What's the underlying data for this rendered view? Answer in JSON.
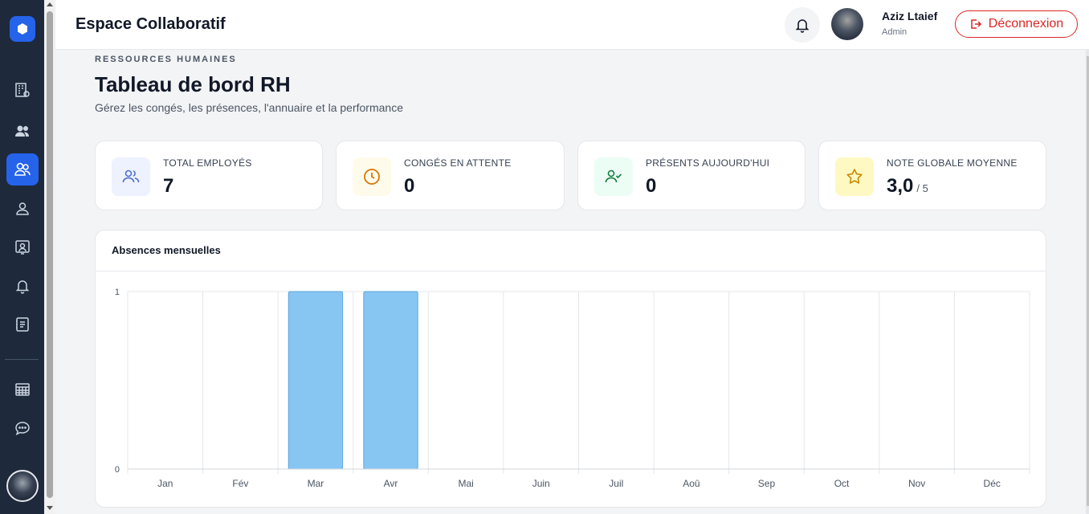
{
  "header": {
    "app_title": "Espace Collaboratif",
    "user_name": "Aziz Ltaief",
    "user_role": "Admin",
    "logout_label": "Déconnexion"
  },
  "page": {
    "kicker": "RESSOURCES HUMAINES",
    "title": "Tableau de bord RH",
    "subtitle": "Gérez les congés, les présences, l'annuaire et la performance"
  },
  "stats": [
    {
      "label": "TOTAL EMPLOYÉS",
      "value": "7",
      "icon": "users-icon",
      "color": "#4f6fd6",
      "bg": "#eef2ff"
    },
    {
      "label": "CONGÉS EN ATTENTE",
      "value": "0",
      "icon": "clock-icon",
      "color": "#d97706",
      "bg": "#fffbeb"
    },
    {
      "label": "PRÉSENTS AUJOURD'HUI",
      "value": "0",
      "icon": "user-check-icon",
      "color": "#15803d",
      "bg": "#ecfdf5"
    },
    {
      "label": "NOTE GLOBALE MOYENNE",
      "value": "3,0",
      "suffix": "/ 5",
      "icon": "star-icon",
      "color": "#ca8a04",
      "bg": "#fef9c3"
    }
  ],
  "sidebar": {
    "items": [
      "building-settings-icon",
      "users-icon",
      "team-icon",
      "user-icon",
      "presentation-icon",
      "bell-icon",
      "notebook-icon",
      "calendar-table-icon",
      "chat-icon"
    ],
    "active_index": 2
  },
  "colors": {
    "sidebar": "#1e293b",
    "accent": "#2563eb",
    "danger": "#dc2626",
    "bar": "#87c6f2",
    "bar_stroke": "#5ba7de"
  },
  "chart_data": {
    "type": "bar",
    "title": "Absences mensuelles",
    "categories": [
      "Jan",
      "Fév",
      "Mar",
      "Avr",
      "Mai",
      "Juin",
      "Juil",
      "Aoû",
      "Sep",
      "Oct",
      "Nov",
      "Déc"
    ],
    "values": [
      0,
      0,
      1,
      1,
      0,
      0,
      0,
      0,
      0,
      0,
      0,
      0
    ],
    "ylim": [
      0,
      1
    ],
    "yticks": [
      0,
      1
    ],
    "grid": true
  }
}
